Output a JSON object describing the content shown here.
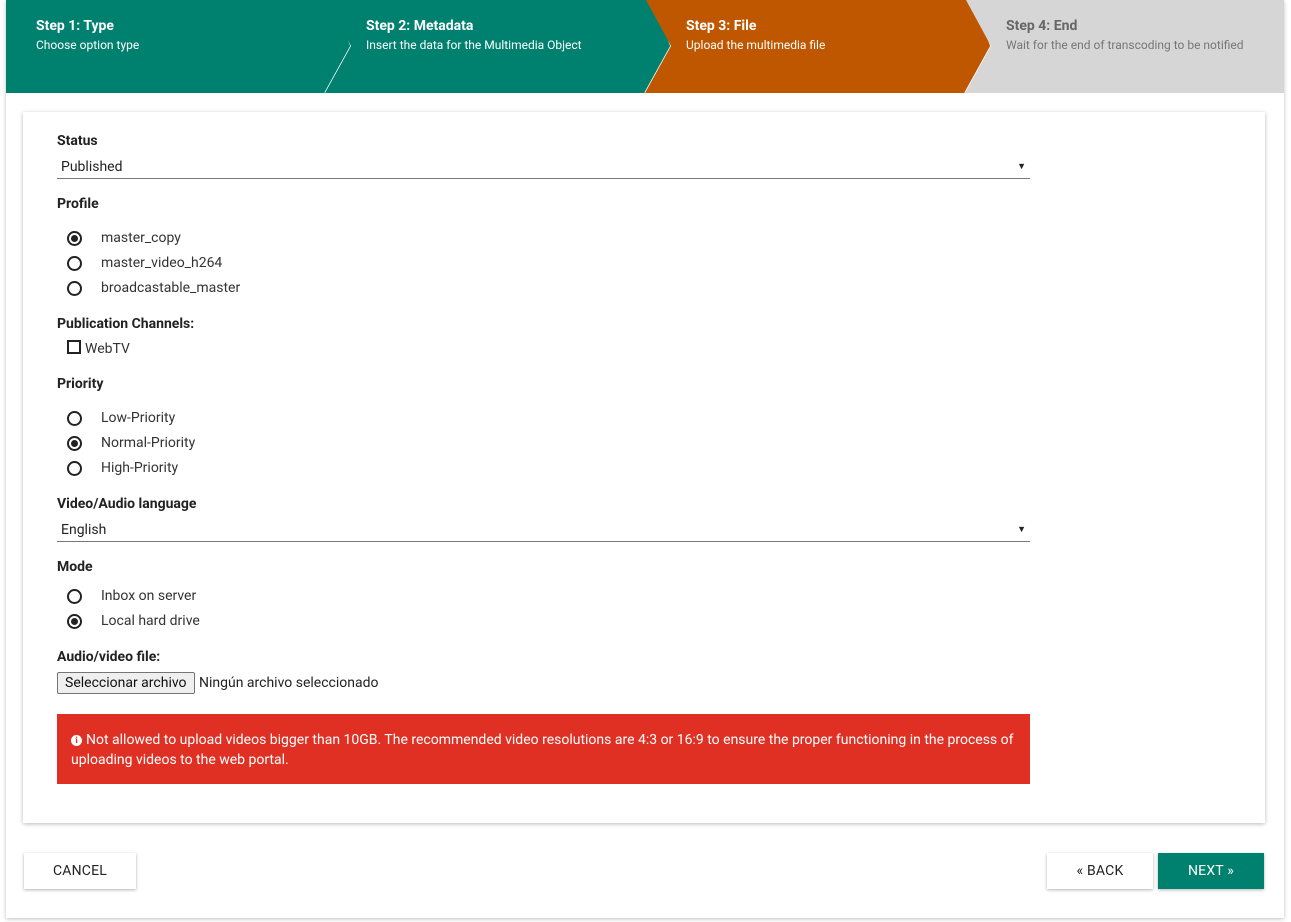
{
  "wizard": {
    "steps": [
      {
        "title": "Step 1: Type",
        "subtitle": "Choose option type",
        "state": "done",
        "color": "#00806f"
      },
      {
        "title": "Step 2: Metadata",
        "subtitle": "Insert the data for the Multimedia Object",
        "state": "done",
        "color": "#00806f"
      },
      {
        "title": "Step 3: File",
        "subtitle": "Upload the multimedia file",
        "state": "current",
        "color": "#bf5600"
      },
      {
        "title": "Step 4: End",
        "subtitle": "Wait for the end of transcoding to be notified",
        "state": "pending",
        "color": "#d6d6d6"
      }
    ]
  },
  "form": {
    "status": {
      "label": "Status",
      "value": "Published"
    },
    "profile": {
      "label": "Profile",
      "options": [
        {
          "label": "master_copy",
          "selected": true
        },
        {
          "label": "master_video_h264",
          "selected": false
        },
        {
          "label": "broadcastable_master",
          "selected": false
        }
      ]
    },
    "channels": {
      "label": "Publication Channels:",
      "options": [
        {
          "label": "WebTV",
          "checked": false
        }
      ]
    },
    "priority": {
      "label": "Priority",
      "options": [
        {
          "label": "Low-Priority",
          "selected": false
        },
        {
          "label": "Normal-Priority",
          "selected": true
        },
        {
          "label": "High-Priority",
          "selected": false
        }
      ]
    },
    "language": {
      "label": "Video/Audio language",
      "value": "English"
    },
    "mode": {
      "label": "Mode",
      "options": [
        {
          "label": "Inbox on server",
          "selected": false
        },
        {
          "label": "Local hard drive",
          "selected": true
        }
      ]
    },
    "file": {
      "label": "Audio/video file:",
      "button": "Seleccionar archivo",
      "status": "Ningún archivo seleccionado"
    },
    "alert": {
      "icon": "info-icon",
      "text": "Not allowed to upload videos bigger than 10GB. The recommended video resolutions are 4:3 or 16:9 to ensure the proper functioning in the process of uploading videos to the web portal.",
      "color": "#e03024"
    }
  },
  "actions": {
    "cancel": "CANCEL",
    "back": "« BACK",
    "next": "NEXT »"
  }
}
